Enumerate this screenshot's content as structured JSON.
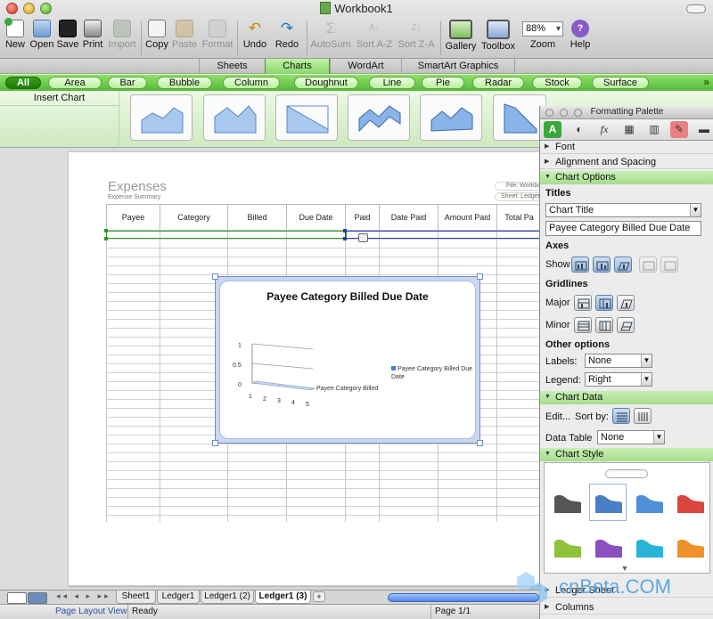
{
  "window": {
    "title": "Workbook1"
  },
  "toolbar": {
    "buttons": [
      {
        "label": "New",
        "icon": "new-workbook-icon",
        "enabled": true
      },
      {
        "label": "Open",
        "icon": "open-folder-icon",
        "enabled": true
      },
      {
        "label": "Save",
        "icon": "save-disk-icon",
        "enabled": true
      },
      {
        "label": "Print",
        "icon": "printer-icon",
        "enabled": true
      },
      {
        "label": "Import",
        "icon": "import-icon",
        "enabled": false
      },
      {
        "label": "Copy",
        "icon": "copy-icon",
        "enabled": true
      },
      {
        "label": "Paste",
        "icon": "paste-icon",
        "enabled": false
      },
      {
        "label": "Format",
        "icon": "format-brush-icon",
        "enabled": false
      },
      {
        "label": "Undo",
        "icon": "undo-icon",
        "enabled": true
      },
      {
        "label": "Redo",
        "icon": "redo-icon",
        "enabled": true
      },
      {
        "label": "AutoSum",
        "icon": "sigma-icon",
        "enabled": false
      },
      {
        "label": "Sort A-Z",
        "icon": "sort-ascending-icon",
        "enabled": false
      },
      {
        "label": "Sort Z-A",
        "icon": "sort-descending-icon",
        "enabled": false
      },
      {
        "label": "Gallery",
        "icon": "gallery-icon",
        "enabled": true
      },
      {
        "label": "Toolbox",
        "icon": "toolbox-icon",
        "enabled": true
      },
      {
        "label": "Zoom",
        "icon": "zoom-field",
        "enabled": true
      },
      {
        "label": "Help",
        "icon": "help-icon",
        "enabled": true
      }
    ],
    "zoom_value": "88%"
  },
  "ribbon": {
    "tabs": [
      "Sheets",
      "Charts",
      "WordArt",
      "SmartArt Graphics"
    ],
    "active_tab": "Charts",
    "chart_types": [
      "All",
      "Area",
      "Bar",
      "Bubble",
      "Column",
      "Doughnut",
      "Line",
      "Pie",
      "Radar",
      "Stock",
      "Surface"
    ],
    "active_type": "All",
    "insert_label": "Insert Chart",
    "more_glyph": "»"
  },
  "document": {
    "title": "Expenses",
    "subtitle": "Expense Summary",
    "file_label": "File: Workbook",
    "sheet_label": "Sheet: Ledger",
    "columns": [
      "Payee",
      "Category",
      "Billed",
      "Due Date",
      "Paid",
      "Date Paid",
      "Amount Paid",
      "Total Pa"
    ]
  },
  "chart": {
    "title": "Payee Category Billed Due Date",
    "legend_text": "Payee Category Billed Due Date",
    "series_label": "Payee Category Billed",
    "y_ticks": [
      "1",
      "0.5",
      "0"
    ],
    "x_ticks": [
      "1",
      "2",
      "3",
      "4",
      "5"
    ]
  },
  "palette": {
    "title": "Formatting Palette",
    "sections": {
      "font": "Font",
      "alignment": "Alignment and Spacing",
      "chart_options": "Chart Options",
      "chart_data": "Chart Data",
      "chart_style": "Chart Style",
      "ledger_sheet": "Ledger Sheet",
      "columns": "Columns"
    },
    "titles_label": "Titles",
    "title_select": "Chart Title",
    "title_text": "Payee Category Billed Due Date",
    "axes_label": "Axes",
    "show_label": "Show",
    "gridlines_label": "Gridlines",
    "major_label": "Major",
    "minor_label": "Minor",
    "other_label": "Other options",
    "labels_label": "Labels:",
    "labels_value": "None",
    "legend_label": "Legend:",
    "legend_value": "Right",
    "edit_label": "Edit...",
    "sortby_label": "Sort by:",
    "datatable_label": "Data Table",
    "datatable_value": "None",
    "style_colors": [
      "#555555",
      "#4a7fc8",
      "#4f8fd6",
      "#d9463f",
      "#8fc23a",
      "#8a4fc0",
      "#2ab4d8",
      "#f0902a"
    ]
  },
  "sheets": {
    "tabs": [
      "Sheet1",
      "Ledger1",
      "Ledger1 (2)",
      "Ledger1 (3)"
    ],
    "active": "Ledger1 (3)",
    "add_glyph": "+"
  },
  "status": {
    "view": "Page Layout View",
    "state": "Ready",
    "page": "Page 1/1"
  },
  "watermark": {
    "text": "cnBeta.COM"
  }
}
